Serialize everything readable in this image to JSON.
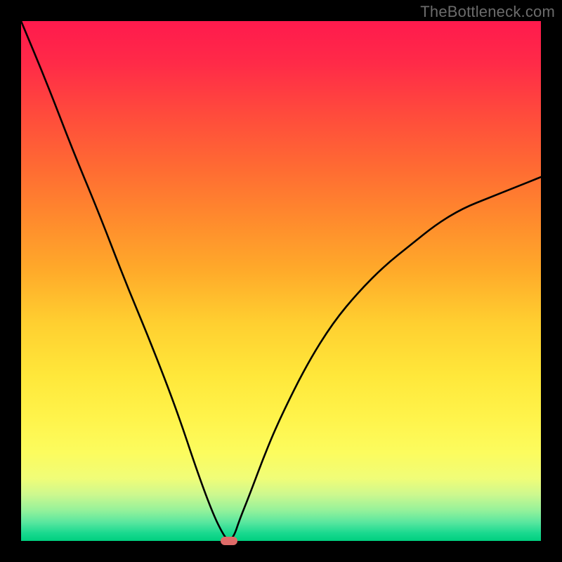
{
  "watermark": "TheBottleneck.com",
  "chart_data": {
    "type": "line",
    "title": "",
    "xlabel": "",
    "ylabel": "",
    "xlim": [
      0,
      100
    ],
    "ylim": [
      0,
      100
    ],
    "grid": false,
    "legend": false,
    "series": [
      {
        "name": "bottleneck-curve",
        "x": [
          0,
          5,
          10,
          15,
          20,
          25,
          30,
          34,
          37,
          39,
          40,
          41,
          42,
          44,
          47,
          50,
          55,
          60,
          65,
          70,
          75,
          80,
          85,
          90,
          95,
          100
        ],
        "values": [
          100,
          88,
          75,
          63,
          50,
          38,
          25,
          13,
          5,
          1,
          0,
          1,
          4,
          9,
          17,
          24,
          34,
          42,
          48,
          53,
          57,
          61,
          64,
          66,
          68,
          70
        ]
      }
    ],
    "marker": {
      "x": 40,
      "y": 0,
      "color": "#de6b68"
    },
    "background_gradient": {
      "top": "#ff1a4d",
      "mid": "#ffe73a",
      "bottom": "#00cf7f"
    }
  }
}
